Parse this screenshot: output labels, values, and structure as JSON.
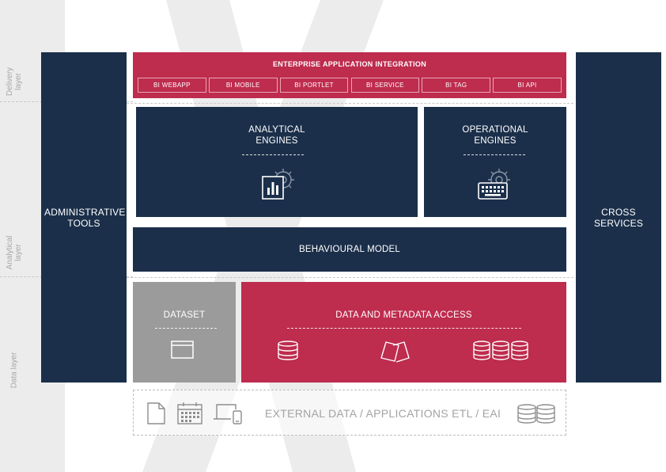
{
  "layers": {
    "delivery": "Delivery layer",
    "analytical": "Analytical layer",
    "data": "Data layer"
  },
  "left_column": {
    "label": "ADMINISTRATIVE TOOLS"
  },
  "right_column": {
    "label": "CROSS SERVICES"
  },
  "eai": {
    "title": "ENTERPRISE APPLICATION INTEGRATION",
    "items": [
      "BI WEBAPP",
      "BI MOBILE",
      "BI PORTLET",
      "BI SERVICE",
      "BI TAG",
      "BI API"
    ]
  },
  "analytical_engines": {
    "title_line1": "ANALYTICAL",
    "title_line2": "ENGINES",
    "icon": "bar-chart-gear-icon"
  },
  "operational_engines": {
    "title_line1": "OPERATIONAL",
    "title_line2": "ENGINES",
    "icon": "keyboard-gear-icon"
  },
  "behavioural_model": {
    "label": "BEHAVIOURAL MODEL"
  },
  "dataset": {
    "title": "DATASET",
    "icon": "window-icon"
  },
  "data_access": {
    "title": "DATA AND METADATA ACCESS",
    "icons": [
      "database-icon",
      "documents-icon",
      "databases-icon"
    ]
  },
  "external": {
    "label": "EXTERNAL DATA / APPLICATIONS ETL / EAI",
    "icons": [
      "file-icon",
      "calendar-icon",
      "devices-icon",
      "databases-icon"
    ]
  },
  "colors": {
    "navy": "#1b2f4a",
    "crimson": "#be2c4e",
    "grey": "#9b9b9b",
    "background_strip": "#ececec"
  }
}
